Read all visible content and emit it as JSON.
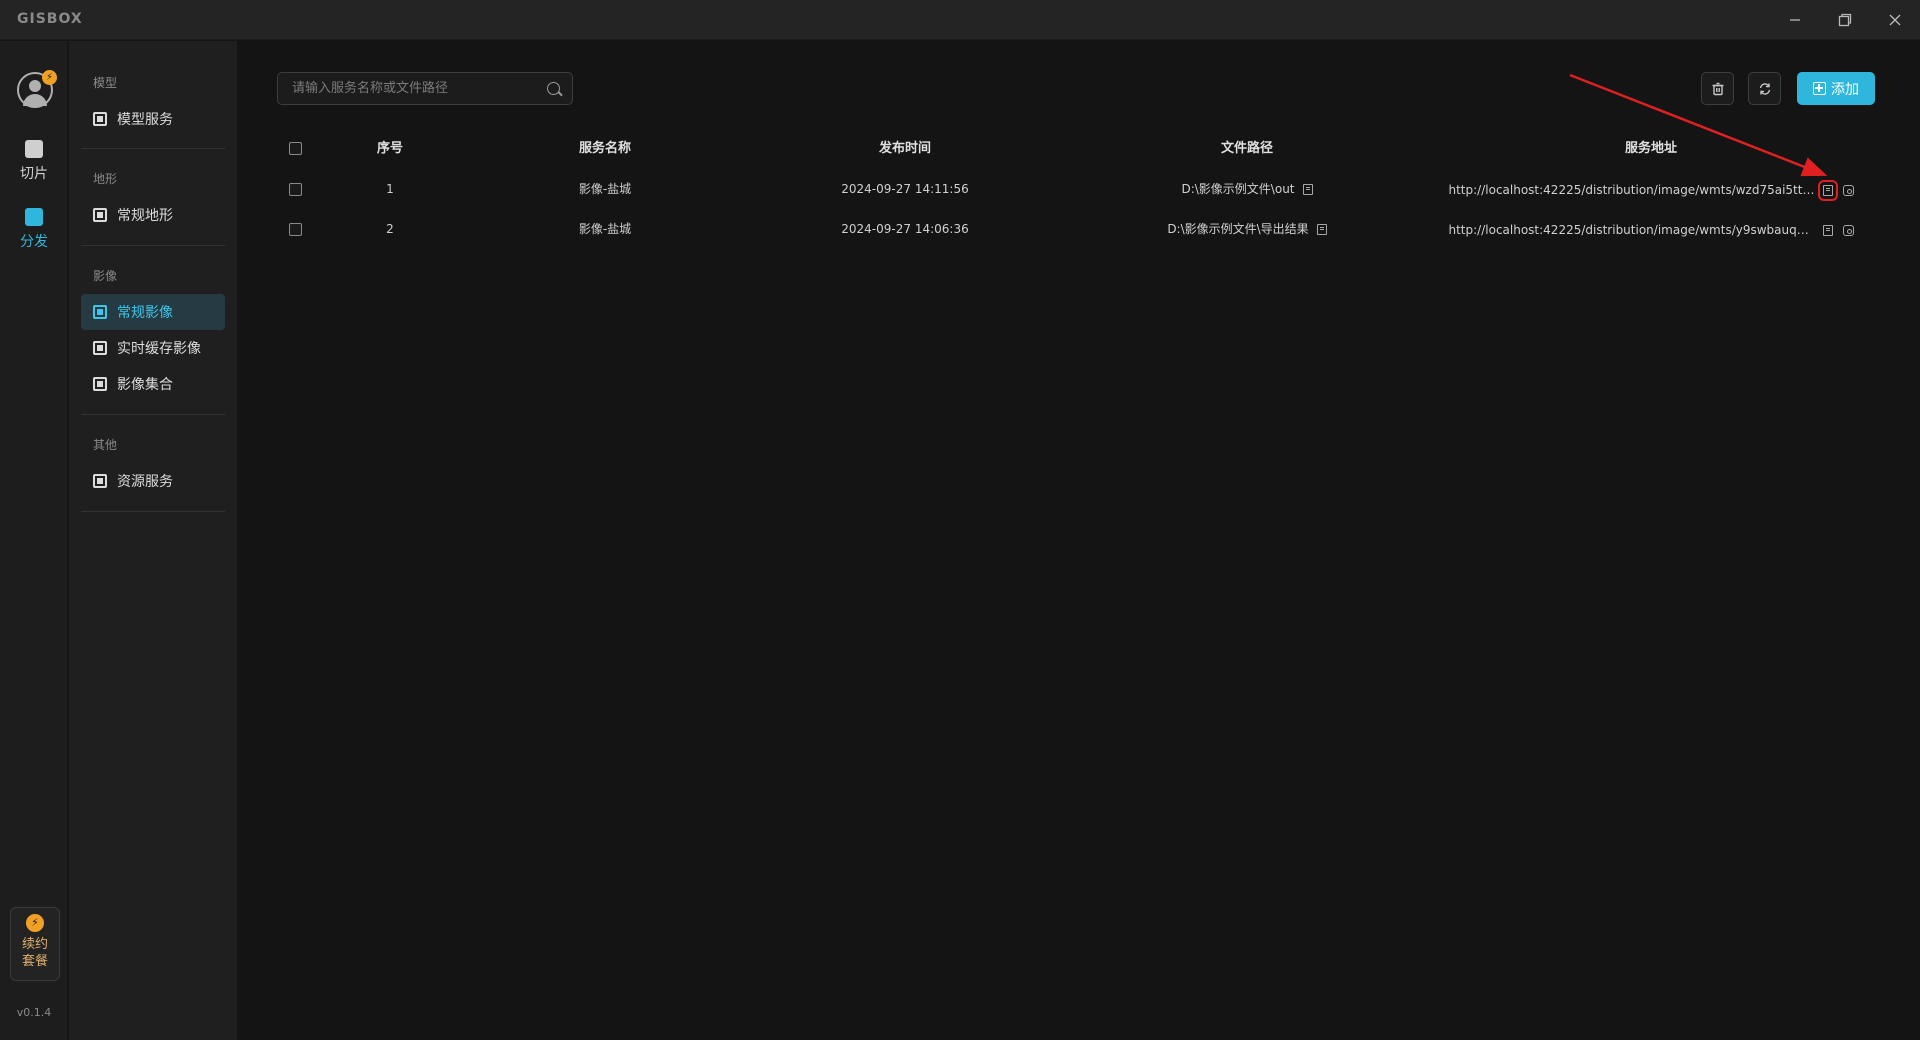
{
  "app": {
    "logo": "GISBOX",
    "version": "v0.1.4"
  },
  "window_controls": {
    "minimize": "minimize-icon",
    "restore": "restore-icon",
    "close": "close-icon"
  },
  "rail": {
    "avatar_badge": "⚡",
    "items": [
      {
        "label": "切片",
        "icon": "slice-icon"
      },
      {
        "label": "分发",
        "icon": "distribute-icon"
      }
    ],
    "renew": {
      "line1": "续约",
      "line2": "套餐",
      "icon": "bolt-icon"
    }
  },
  "sidebar": {
    "groups": [
      {
        "label": "模型",
        "items": [
          {
            "label": "模型服务"
          }
        ]
      },
      {
        "label": "地形",
        "items": [
          {
            "label": "常规地形"
          }
        ]
      },
      {
        "label": "影像",
        "items": [
          {
            "label": "常规影像"
          },
          {
            "label": "实时缓存影像"
          },
          {
            "label": "影像集合"
          }
        ]
      },
      {
        "label": "其他",
        "items": [
          {
            "label": "资源服务"
          }
        ]
      }
    ],
    "active": "常规影像",
    "accent_color": "#3cc6ea"
  },
  "toolbar": {
    "search_placeholder": "请输入服务名称或文件路径",
    "add_label": "添加",
    "delete_icon": "trash-icon",
    "refresh_icon": "refresh-icon"
  },
  "table": {
    "headers": {
      "idx": "序号",
      "name": "服务名称",
      "time": "发布时间",
      "path": "文件路径",
      "url": "服务地址"
    },
    "rows": [
      {
        "idx": "1",
        "name": "影像-盐城",
        "time": "2024-09-27 14:11:56",
        "path": "D:\\影像示例文件\\out",
        "url": "http://localhost:42225/distribution/image/wmts/wzd75ai5tta..."
      },
      {
        "idx": "2",
        "name": "影像-盐城",
        "time": "2024-09-27 14:06:36",
        "path": "D:\\影像示例文件\\导出结果",
        "url": "http://localhost:42225/distribution/image/wmts/y9swbauqh5..."
      }
    ]
  },
  "colors": {
    "accent": "#2fb6dc",
    "annotation": "#e02020"
  }
}
